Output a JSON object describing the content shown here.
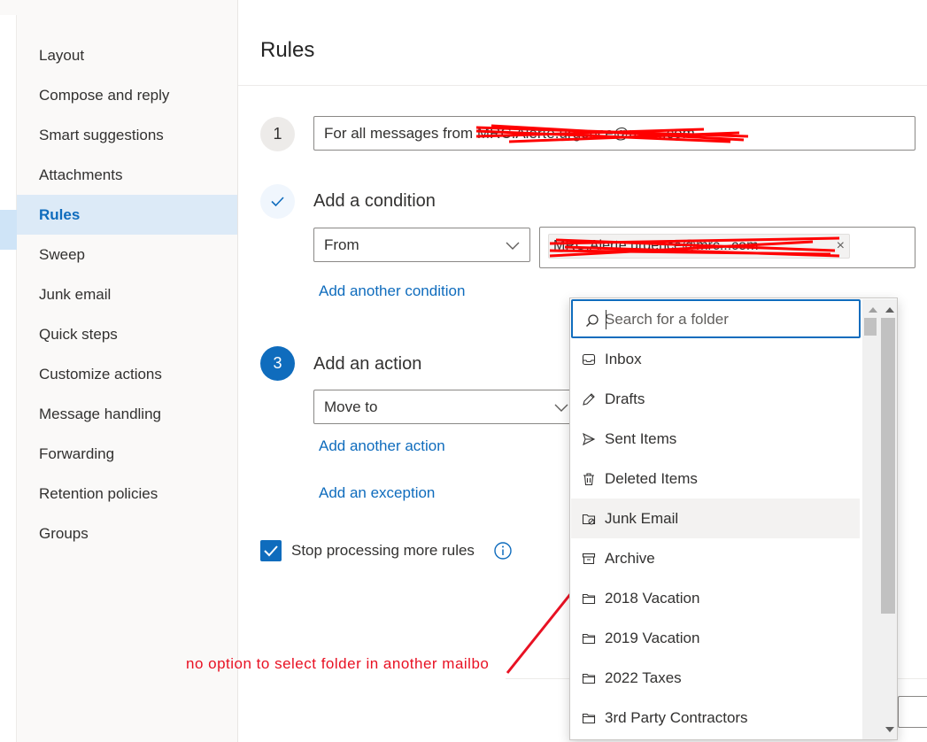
{
  "nav": {
    "items": [
      {
        "label": "Layout"
      },
      {
        "label": "Compose and reply"
      },
      {
        "label": "Smart suggestions"
      },
      {
        "label": "Attachments"
      },
      {
        "label": "Rules",
        "selected": true
      },
      {
        "label": "Sweep"
      },
      {
        "label": "Junk email"
      },
      {
        "label": "Quick steps"
      },
      {
        "label": "Customize actions"
      },
      {
        "label": "Message handling"
      },
      {
        "label": "Forwarding"
      },
      {
        "label": "Retention policies"
      },
      {
        "label": "Groups"
      }
    ]
  },
  "page": {
    "title": "Rules"
  },
  "rule": {
    "step1_number": "1",
    "name_value": "For all messages from MRC.Alerte.urgence@mrc...com",
    "condition_heading": "Add a condition",
    "condition_field": "From",
    "from_pill": "MRC.Alerte.urgence@mrc...com",
    "pill_remove": "×",
    "add_condition_link": "Add another condition",
    "step3_number": "3",
    "action_heading": "Add an action",
    "action_field": "Move to",
    "add_action_link": "Add another action",
    "add_exception_link": "Add an exception",
    "stop_processing_label": "Stop processing more rules",
    "stop_processing_checked": true
  },
  "folder_picker": {
    "search_placeholder": "Search for a folder",
    "folders": [
      {
        "label": "Inbox",
        "icon": "inbox-icon"
      },
      {
        "label": "Drafts",
        "icon": "pencil-icon"
      },
      {
        "label": "Sent Items",
        "icon": "send-icon"
      },
      {
        "label": "Deleted Items",
        "icon": "trash-icon"
      },
      {
        "label": "Junk Email",
        "icon": "junk-folder-icon",
        "hovered": true
      },
      {
        "label": "Archive",
        "icon": "archive-icon"
      },
      {
        "label": "2018 Vacation",
        "icon": "folder-icon"
      },
      {
        "label": "2019 Vacation",
        "icon": "folder-icon"
      },
      {
        "label": "2022 Taxes",
        "icon": "folder-icon"
      },
      {
        "label": "3rd Party Contractors",
        "icon": "folder-icon"
      }
    ]
  },
  "annotation": {
    "text": "no option to select folder in another mailbo"
  },
  "colors": {
    "accent": "#0f6cbd",
    "annotation": "#e81123",
    "redaction": "#ff0000"
  }
}
